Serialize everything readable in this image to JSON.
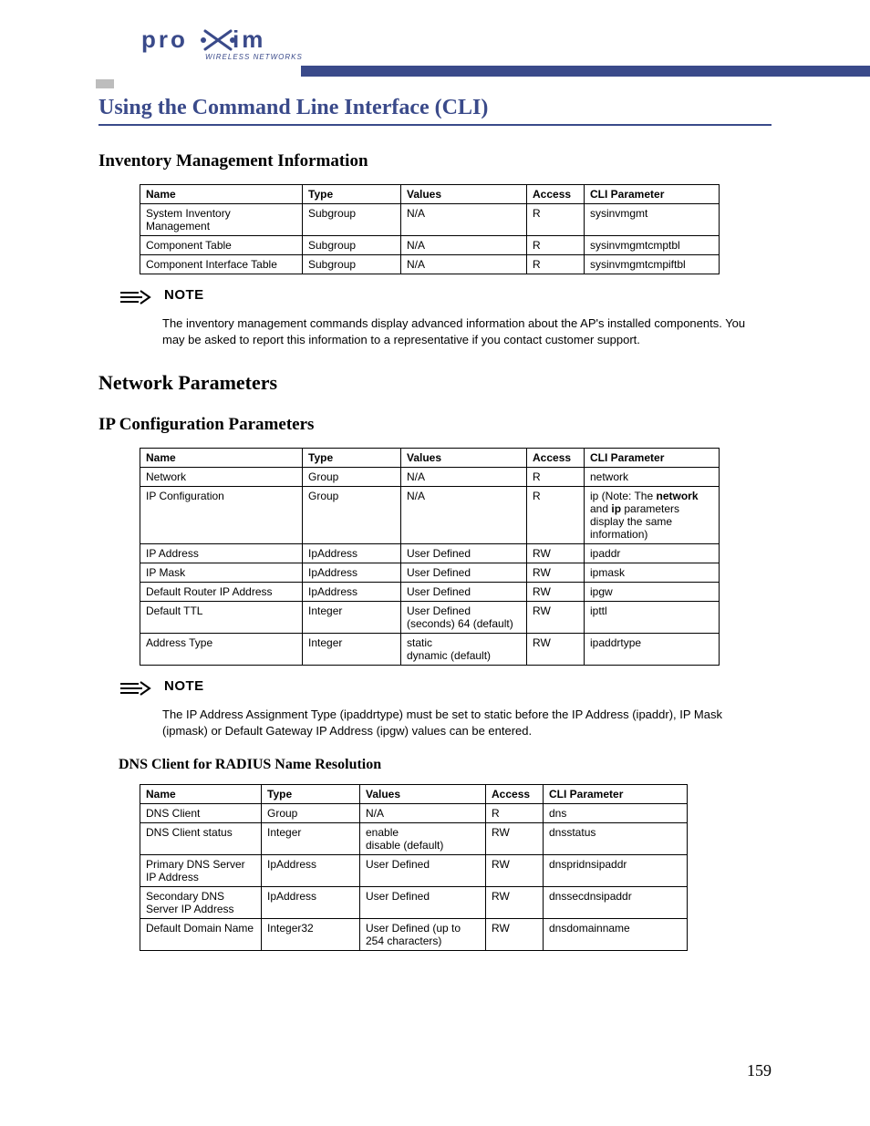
{
  "brand": {
    "name": "proxim",
    "tagline": "WIRELESS NETWORKS"
  },
  "page_number": "159",
  "main_title": "Using the Command Line Interface (CLI)",
  "section1": {
    "title": "Inventory Management Information",
    "headers": {
      "name": "Name",
      "type": "Type",
      "values": "Values",
      "access": "Access",
      "cli": "CLI Parameter"
    },
    "rows": [
      {
        "name": "System Inventory Management",
        "type": "Subgroup",
        "values": "N/A",
        "access": "R",
        "cli": "sysinvmgmt"
      },
      {
        "name": "Component Table",
        "type": "Subgroup",
        "values": "N/A",
        "access": "R",
        "cli": "sysinvmgmtcmptbl"
      },
      {
        "name": "Component Interface Table",
        "type": "Subgroup",
        "values": "N/A",
        "access": "R",
        "cli": "sysinvmgmtcmpiftbl"
      }
    ],
    "note_label": "NOTE",
    "note_text": "The inventory management commands display advanced information about the AP's installed components. You may be asked to report this information to a representative if you contact customer support."
  },
  "section2": {
    "title": "Network Parameters",
    "sub_title": "IP Configuration Parameters",
    "headers": {
      "name": "Name",
      "type": "Type",
      "values": "Values",
      "access": "Access",
      "cli": "CLI Parameter"
    },
    "rows": [
      {
        "name": "Network",
        "type": "Group",
        "values": "N/A",
        "access": "R",
        "cli": "network"
      },
      {
        "name": "IP Configuration",
        "type": "Group",
        "values": "N/A",
        "access": "R",
        "cli_html": "ip (Note: The <b>network</b> and <b>ip</b> parameters display the same information)"
      },
      {
        "name": "IP Address",
        "type": "IpAddress",
        "values": "User Defined",
        "access": "RW",
        "cli": "ipaddr"
      },
      {
        "name": "IP Mask",
        "type": "IpAddress",
        "values": "User Defined",
        "access": "RW",
        "cli": "ipmask"
      },
      {
        "name": "Default Router IP Address",
        "type": "IpAddress",
        "values": "User Defined",
        "access": "RW",
        "cli": "ipgw"
      },
      {
        "name": "Default TTL",
        "type": "Integer",
        "values": "User Defined (seconds) 64 (default)",
        "access": "RW",
        "cli": "ipttl"
      },
      {
        "name": "Address Type",
        "type": "Integer",
        "values": "static\ndynamic (default)",
        "access": "RW",
        "cli": "ipaddrtype"
      }
    ],
    "note_label": "NOTE",
    "note_text": "The IP Address Assignment Type (ipaddrtype) must be set to static before the IP Address (ipaddr), IP Mask (ipmask) or Default Gateway IP Address (ipgw) values can be entered."
  },
  "section3": {
    "title": "DNS Client for RADIUS Name Resolution",
    "headers": {
      "name": "Name",
      "type": "Type",
      "values": "Values",
      "access": "Access",
      "cli": "CLI Parameter"
    },
    "rows": [
      {
        "name": "DNS Client",
        "type": "Group",
        "values": "N/A",
        "access": "R",
        "cli": "dns"
      },
      {
        "name": "DNS Client status",
        "type": "Integer",
        "values": "enable\ndisable (default)",
        "access": "RW",
        "cli": "dnsstatus"
      },
      {
        "name": "Primary DNS Server IP Address",
        "type": "IpAddress",
        "values": "User Defined",
        "access": "RW",
        "cli": "dnspridnsipaddr"
      },
      {
        "name": "Secondary DNS Server IP Address",
        "type": "IpAddress",
        "values": "User Defined",
        "access": "RW",
        "cli": "dnssecdnsipaddr"
      },
      {
        "name": "Default Domain Name",
        "type": "Integer32",
        "values": "User Defined (up to 254 characters)",
        "access": "RW",
        "cli": "dnsdomainname"
      }
    ]
  }
}
